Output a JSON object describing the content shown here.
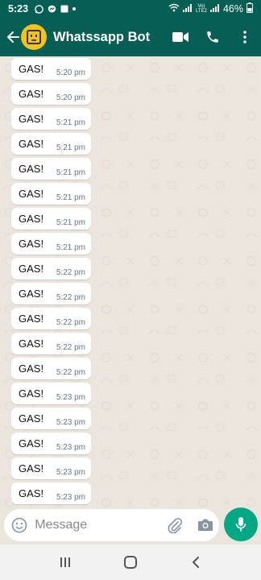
{
  "status_bar": {
    "time": "5:23",
    "battery": "46%",
    "network_label": "Vo) LTE2"
  },
  "header": {
    "title": "Whatssapp Bot"
  },
  "composer": {
    "placeholder": "Message"
  },
  "messages": [
    {
      "text": "GAS!",
      "time": "5:20 pm"
    },
    {
      "text": "GAS!",
      "time": "5:20 pm"
    },
    {
      "text": "GAS!",
      "time": "5:21 pm"
    },
    {
      "text": "GAS!",
      "time": "5:21 pm"
    },
    {
      "text": "GAS!",
      "time": "5:21 pm"
    },
    {
      "text": "GAS!",
      "time": "5:21 pm"
    },
    {
      "text": "GAS!",
      "time": "5:21 pm"
    },
    {
      "text": "GAS!",
      "time": "5:21 pm"
    },
    {
      "text": "GAS!",
      "time": "5:22 pm"
    },
    {
      "text": "GAS!",
      "time": "5:22 pm"
    },
    {
      "text": "GAS!",
      "time": "5:22 pm"
    },
    {
      "text": "GAS!",
      "time": "5:22 pm"
    },
    {
      "text": "GAS!",
      "time": "5:22 pm"
    },
    {
      "text": "GAS!",
      "time": "5:23 pm"
    },
    {
      "text": "GAS!",
      "time": "5:23 pm"
    },
    {
      "text": "GAS!",
      "time": "5:23 pm"
    },
    {
      "text": "GAS!",
      "time": "5:23 pm"
    },
    {
      "text": "GAS!",
      "time": "5:23 pm"
    }
  ],
  "icons": {
    "status": [
      "whatsapp-notification-icon",
      "messenger-icon",
      "gallery-icon",
      "dot-icon",
      "wifi-icon",
      "signal-icon",
      "battery-icon"
    ],
    "header": [
      "back-arrow-icon",
      "bot-avatar-icon",
      "video-call-icon",
      "voice-call-icon",
      "more-options-icon"
    ],
    "composer": [
      "emoji-icon",
      "attach-icon",
      "camera-icon",
      "mic-icon"
    ],
    "nav": [
      "recents-icon",
      "home-icon",
      "back-icon"
    ]
  },
  "colors": {
    "header": "#075e54",
    "chat_background": "#ece5dd",
    "bubble": "#ffffff",
    "mic_button": "#00a884",
    "avatar": "#f6c21c"
  }
}
